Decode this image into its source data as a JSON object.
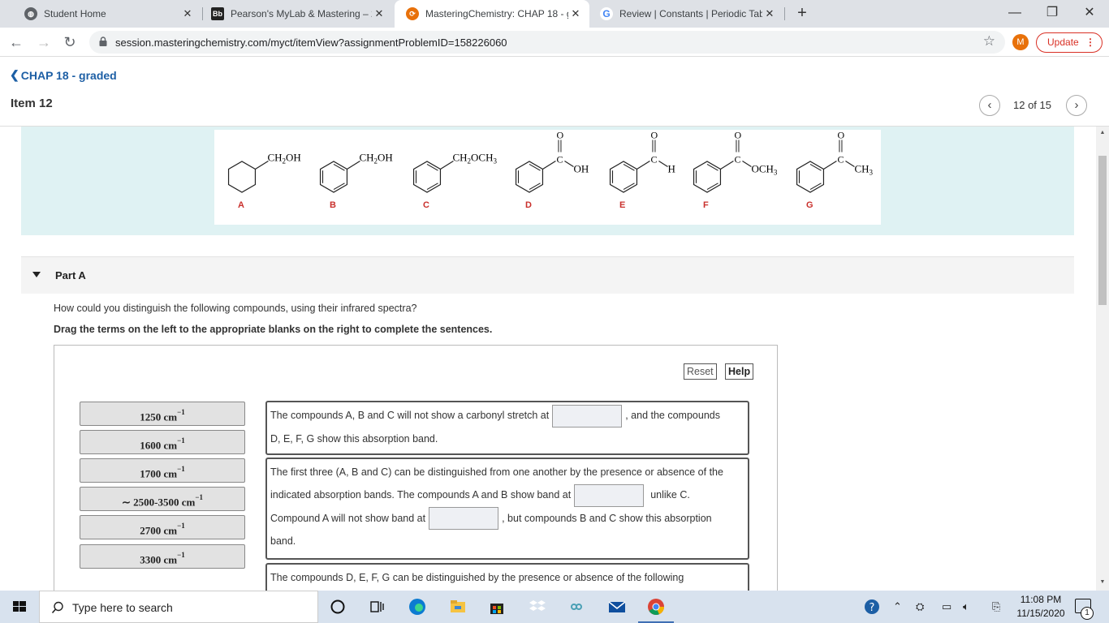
{
  "browser": {
    "tabs": [
      {
        "title": "Student Home",
        "icon": "globe-icon",
        "active": false
      },
      {
        "title": "Pearson's MyLab & Mastering – 2",
        "icon": "blackboard-icon",
        "active": false
      },
      {
        "title": "MasteringChemistry: CHAP 18 - g",
        "icon": "mastering-icon",
        "active": true
      },
      {
        "title": "Review | Constants | Periodic Tabl",
        "icon": "google-icon",
        "active": false
      }
    ],
    "new_tab": "+",
    "url": "session.masteringchemistry.com/myct/itemView?assignmentProblemID=158226060",
    "profile_initial": "M",
    "update_label": "Update",
    "update_dots": "⋮"
  },
  "header": {
    "back_label": "CHAP 18 - graded",
    "item_title": "Item 12",
    "pager": "12 of 15"
  },
  "structures": {
    "compounds": [
      {
        "label": "A",
        "substituent": "CH2OH"
      },
      {
        "label": "B",
        "substituent": "CH2OH"
      },
      {
        "label": "C",
        "substituent": "CH2OCH3"
      },
      {
        "label": "D",
        "substituent": "OH"
      },
      {
        "label": "E",
        "substituent": "H"
      },
      {
        "label": "F",
        "substituent": "OCH3"
      },
      {
        "label": "G",
        "substituent": "CH3"
      }
    ],
    "carbonyl_C": "C",
    "carbonyl_O": "O"
  },
  "part": {
    "title": "Part A",
    "question": "How could you distinguish the following compounds, using their infrared spectra?",
    "instruction": "Drag the terms on the left to the appropriate blanks on the right to complete the sentences."
  },
  "buttons": {
    "reset": "Reset",
    "help": "Help"
  },
  "terms": [
    {
      "text": "1250 cm",
      "sup": "−1"
    },
    {
      "text": "1600 cm",
      "sup": "−1"
    },
    {
      "text": "1700 cm",
      "sup": "−1"
    },
    {
      "text": "∼ 2500-3500 cm",
      "sup": "−1"
    },
    {
      "text": "2700 cm",
      "sup": "−1"
    },
    {
      "text": "3300 cm",
      "sup": "−1"
    }
  ],
  "sentences": {
    "s1_a": "The compounds A, B and C will not show a carbonyl stretch at",
    "s1_b": ", and the compounds",
    "s1_c": "D, E, F, G show this absorption band.",
    "s2_a": "The first three (A, B and C) can be distinguished from one another by the presence or absence of the",
    "s2_b": "indicated absorption bands. The compounds A and B show band at",
    "s2_c": "unlike C.",
    "s2_d": "Compound A will not show band at",
    "s2_e": ", but compounds B and C show this absorption",
    "s2_f": "band.",
    "s3_a": "The compounds D, E, F, G can be distinguished by the presence or absence of the following"
  },
  "taskbar": {
    "search_placeholder": "Type here to search",
    "time": "11:08 PM",
    "date": "11/15/2020",
    "notification_count": "1"
  }
}
